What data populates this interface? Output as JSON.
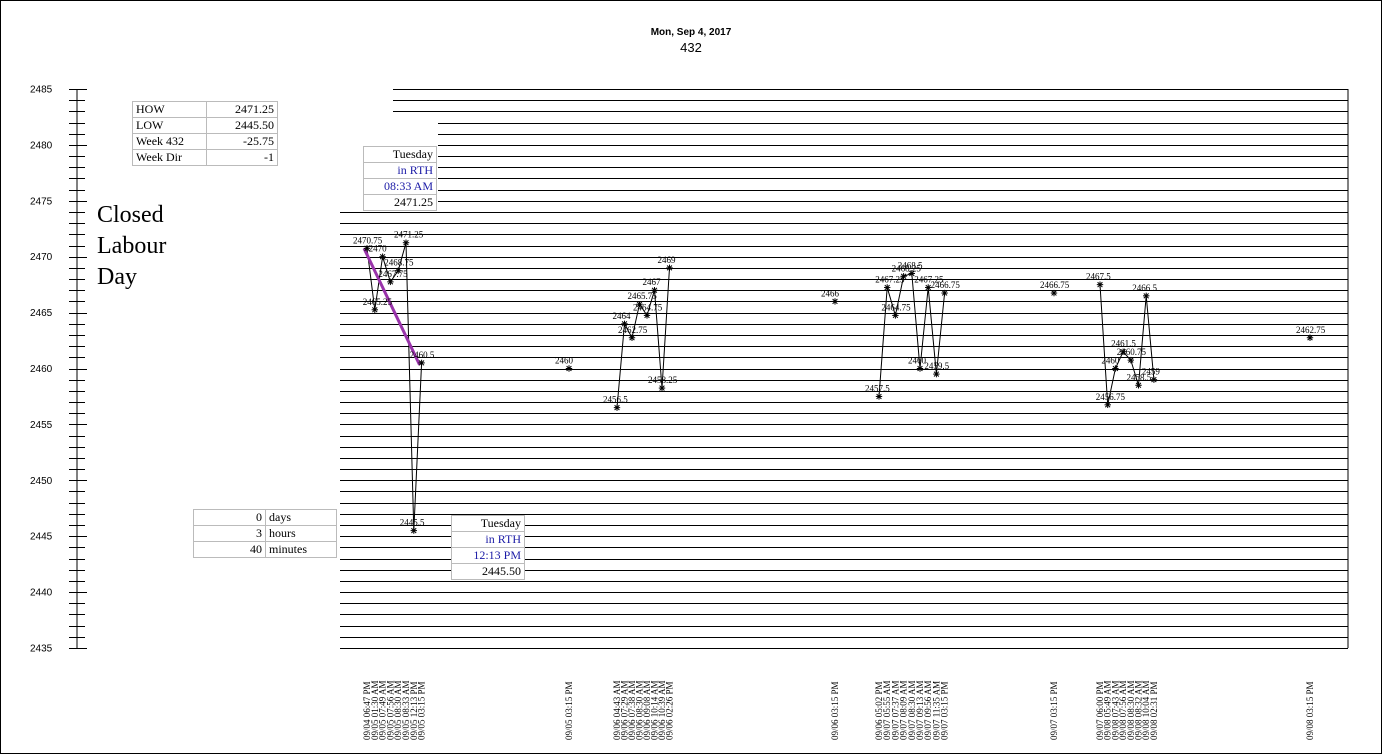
{
  "header": {
    "date": "Mon, Sep 4, 2017",
    "week": "432"
  },
  "stats": [
    {
      "label": "HOW",
      "value": "2471.25"
    },
    {
      "label": "LOW",
      "value": "2445.50"
    },
    {
      "label": "Week 432",
      "value": "-25.75"
    },
    {
      "label": "Week Dir",
      "value": "-1"
    }
  ],
  "high_box": {
    "day": "Tuesday",
    "session": "in RTH",
    "time": "08:33 AM",
    "price": "2471.25"
  },
  "low_box": {
    "day": "Tuesday",
    "session": "in RTH",
    "time": "12:13 PM",
    "price": "2445.50"
  },
  "duration": [
    {
      "value": "0",
      "unit": "days"
    },
    {
      "value": "3",
      "unit": "hours"
    },
    {
      "value": "40",
      "unit": "minutes"
    }
  ],
  "closed_note": [
    "Closed",
    "Labour",
    "Day"
  ],
  "colors": {
    "hl_line": "#9933aa",
    "box_text": "#1a1aa6"
  },
  "chart_data": {
    "type": "line",
    "ylim": [
      2435,
      2485
    ],
    "yticks": [
      2435,
      2440,
      2445,
      2450,
      2455,
      2460,
      2465,
      2470,
      2475,
      2480,
      2485
    ],
    "hl_segment": [
      0,
      7
    ],
    "groups": [
      {
        "points": [
          {
            "x": "09/04 06:47 PM",
            "y": 2470.75,
            "label": "2470.75"
          },
          {
            "x": "09/05 01:30 AM",
            "y": 2465.25,
            "label": "2465.25"
          },
          {
            "x": "09/05 07:49 AM",
            "y": 2470,
            "label": "2470"
          },
          {
            "x": "09/05 07:56 AM",
            "y": 2467.75,
            "label": "2467.75"
          },
          {
            "x": "09/05 08:30 AM",
            "y": 2468.75,
            "label": "2468.75"
          },
          {
            "x": "09/05 08:33 AM",
            "y": 2471.25,
            "label": "2471.25"
          },
          {
            "x": "09/05 12:13 PM",
            "y": 2445.5,
            "label": "2445.5"
          },
          {
            "x": "09/05 03:15 PM",
            "y": 2460.5,
            "label": "2460.5"
          }
        ]
      },
      {
        "points": [
          {
            "x": "09/05 03:15 PM",
            "y": 2460,
            "label": "2460"
          }
        ]
      },
      {
        "points": [
          {
            "x": "09/06 04:43 AM",
            "y": 2456.5,
            "label": "2456.5"
          },
          {
            "x": "09/06 07:29 AM",
            "y": 2464,
            "label": "2464"
          },
          {
            "x": "09/06 07:38 AM",
            "y": 2462.75,
            "label": "2462.75"
          },
          {
            "x": "09/06 08:30 AM",
            "y": 2465.75,
            "label": "2465.75"
          },
          {
            "x": "09/06 09:08 AM",
            "y": 2464.75,
            "label": "2464.75"
          },
          {
            "x": "09/06 10:14 AM",
            "y": 2467,
            "label": "2467"
          },
          {
            "x": "09/06 10:39 AM",
            "y": 2458.25,
            "label": "2458.25"
          },
          {
            "x": "09/06 02:26 PM",
            "y": 2469,
            "label": "2469"
          }
        ]
      },
      {
        "points": [
          {
            "x": "09/06 03:15 PM",
            "y": 2466,
            "label": "2466"
          }
        ]
      },
      {
        "points": [
          {
            "x": "09/06 05:02 PM",
            "y": 2457.5,
            "label": "2457.5"
          },
          {
            "x": "09/07 05:55 AM",
            "y": 2467.25,
            "label": "2467.25"
          },
          {
            "x": "09/07 07:37 AM",
            "y": 2464.75,
            "label": "2464.75"
          },
          {
            "x": "09/07 08:09 AM",
            "y": 2468.25,
            "label": "2468.25"
          },
          {
            "x": "09/07 08:30 AM",
            "y": 2468.5,
            "label": "2468.5"
          },
          {
            "x": "09/07 09:13 AM",
            "y": 2460,
            "label": "2460"
          },
          {
            "x": "09/07 09:56 AM",
            "y": 2467.25,
            "label": "2467.25"
          },
          {
            "x": "09/07 11:35 AM",
            "y": 2459.5,
            "label": "2459.5"
          },
          {
            "x": "09/07 03:15 PM",
            "y": 2466.75,
            "label": "2466.75"
          }
        ]
      },
      {
        "points": [
          {
            "x": "09/07 03:15 PM",
            "y": 2466.75,
            "label": "2466.75"
          }
        ]
      },
      {
        "points": [
          {
            "x": "09/07 06:00 PM",
            "y": 2467.5,
            "label": "2467.5"
          },
          {
            "x": "09/08 05:49 AM",
            "y": 2456.75,
            "label": "2456.75"
          },
          {
            "x": "09/08 07:43 AM",
            "y": 2460,
            "label": "2460"
          },
          {
            "x": "09/08 07:56 AM",
            "y": 2461.5,
            "label": "2461.5"
          },
          {
            "x": "09/08 08:30 AM",
            "y": 2460.75,
            "label": "2460.75"
          },
          {
            "x": "09/08 08:32 AM",
            "y": 2458.5,
            "label": "2458.5"
          },
          {
            "x": "09/08 10:04 AM",
            "y": 2466.5,
            "label": "2466.5"
          },
          {
            "x": "09/08 02:31 PM",
            "y": 2459,
            "label": "2459"
          }
        ]
      },
      {
        "points": [
          {
            "x": "09/08 03:15 PM",
            "y": 2462.75,
            "label": "2462.75"
          }
        ]
      }
    ]
  }
}
